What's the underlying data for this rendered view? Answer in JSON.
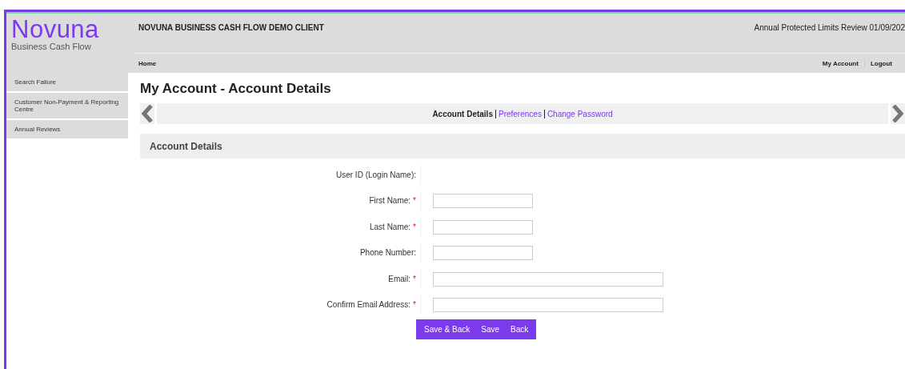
{
  "logo": {
    "name": "Novuna",
    "tagline": "Business Cash Flow"
  },
  "header": {
    "client": "NOVUNA BUSINESS CASH FLOW DEMO CLIENT",
    "notice": "Annual Protected Limits Review 01/09/202"
  },
  "nav": {
    "left": [
      "Home"
    ],
    "right": [
      "My Account",
      "Logout"
    ]
  },
  "sidebar": {
    "items": [
      {
        "label": "Search Failure",
        "selected": false
      },
      {
        "label": "Customer Non-Payment & Reporting Centre",
        "selected": false
      },
      {
        "label": "Annual Reviews",
        "selected": false
      }
    ]
  },
  "page_title": "My Account - Account Details",
  "tabs": [
    {
      "label": "Account Details",
      "selected": true
    },
    {
      "label": "Preferences",
      "selected": false
    },
    {
      "label": "Change Password",
      "selected": false
    }
  ],
  "section_title": "Account Details",
  "fields": [
    {
      "label": "User ID (Login Name):",
      "required": false,
      "kind": "readonly"
    },
    {
      "label": "First Name:",
      "required": true,
      "kind": "short"
    },
    {
      "label": "Last Name:",
      "required": true,
      "kind": "short"
    },
    {
      "label": "Phone Number:",
      "required": false,
      "kind": "short"
    },
    {
      "label": "Email:",
      "required": true,
      "kind": "long"
    },
    {
      "label": "Confirm Email Address:",
      "required": true,
      "kind": "long"
    }
  ],
  "required_mark": "*",
  "buttons": [
    "Save & Back",
    "Save",
    "Back"
  ]
}
